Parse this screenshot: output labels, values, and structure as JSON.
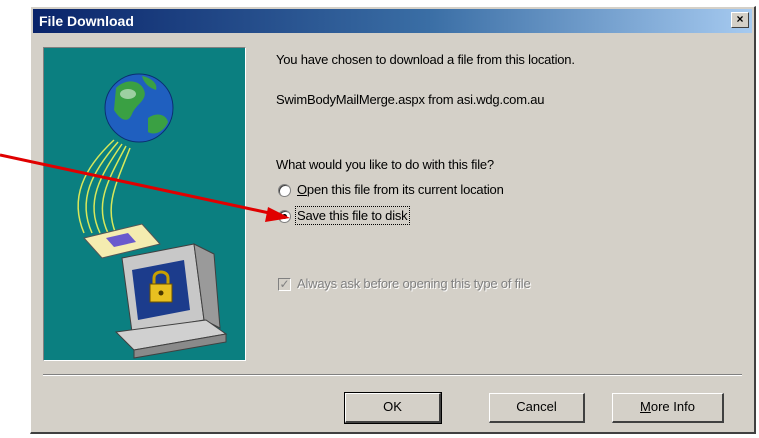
{
  "dialog": {
    "title": "File Download",
    "close_glyph": "×",
    "message": "You have chosen to download a file from this location.",
    "source": "SwimBodyMailMerge.aspx from asi.wdg.com.au",
    "question": "What would you like to do with this file?",
    "options": [
      {
        "label": "Open this file from its current location",
        "selected": false
      },
      {
        "label": "Save this file to disk",
        "selected": true
      }
    ],
    "always_ask": {
      "label": "Always ask before opening this type of file",
      "checked": true,
      "enabled": false
    },
    "buttons": {
      "ok": "OK",
      "cancel": "Cancel",
      "more_info": "More Info"
    }
  },
  "illustration": {
    "icons": [
      "globe-icon",
      "computer-icon",
      "padlock-icon",
      "document-icon"
    ],
    "background_color": "#0b7f80"
  },
  "annotation": {
    "icon": "red-arrow-icon",
    "color": "#e00000"
  }
}
